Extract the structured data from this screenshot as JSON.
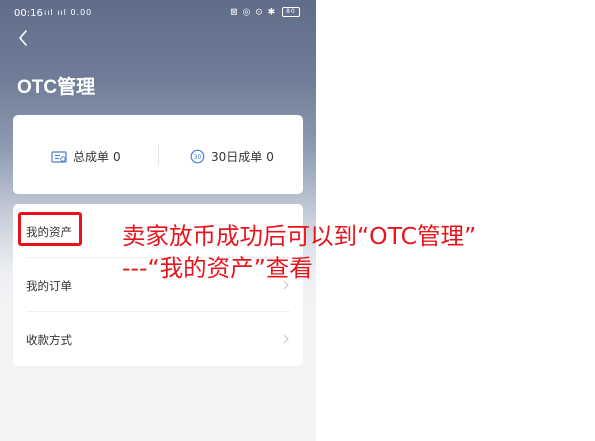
{
  "status_bar": {
    "time": "00:16",
    "signal": "ııl ııl",
    "speed": "0.00",
    "icons": "⊠ ◎ ⊙ ✱",
    "battery": "80"
  },
  "header": {
    "title": "OTC管理"
  },
  "stats": {
    "total_orders_label": "总成单",
    "total_orders_value": "0",
    "orders_30d_label": "30日成单",
    "orders_30d_value": "0"
  },
  "menu": {
    "items": [
      {
        "label": "我的资产"
      },
      {
        "label": "我的订单"
      },
      {
        "label": "收款方式"
      }
    ]
  },
  "annotation": {
    "line1": "卖家放币成功后可以到“OTC管理”",
    "line2": "---“我的资产”查看"
  },
  "colors": {
    "annotation": "#e8141b",
    "stat_icon": "#4a7fd6"
  }
}
